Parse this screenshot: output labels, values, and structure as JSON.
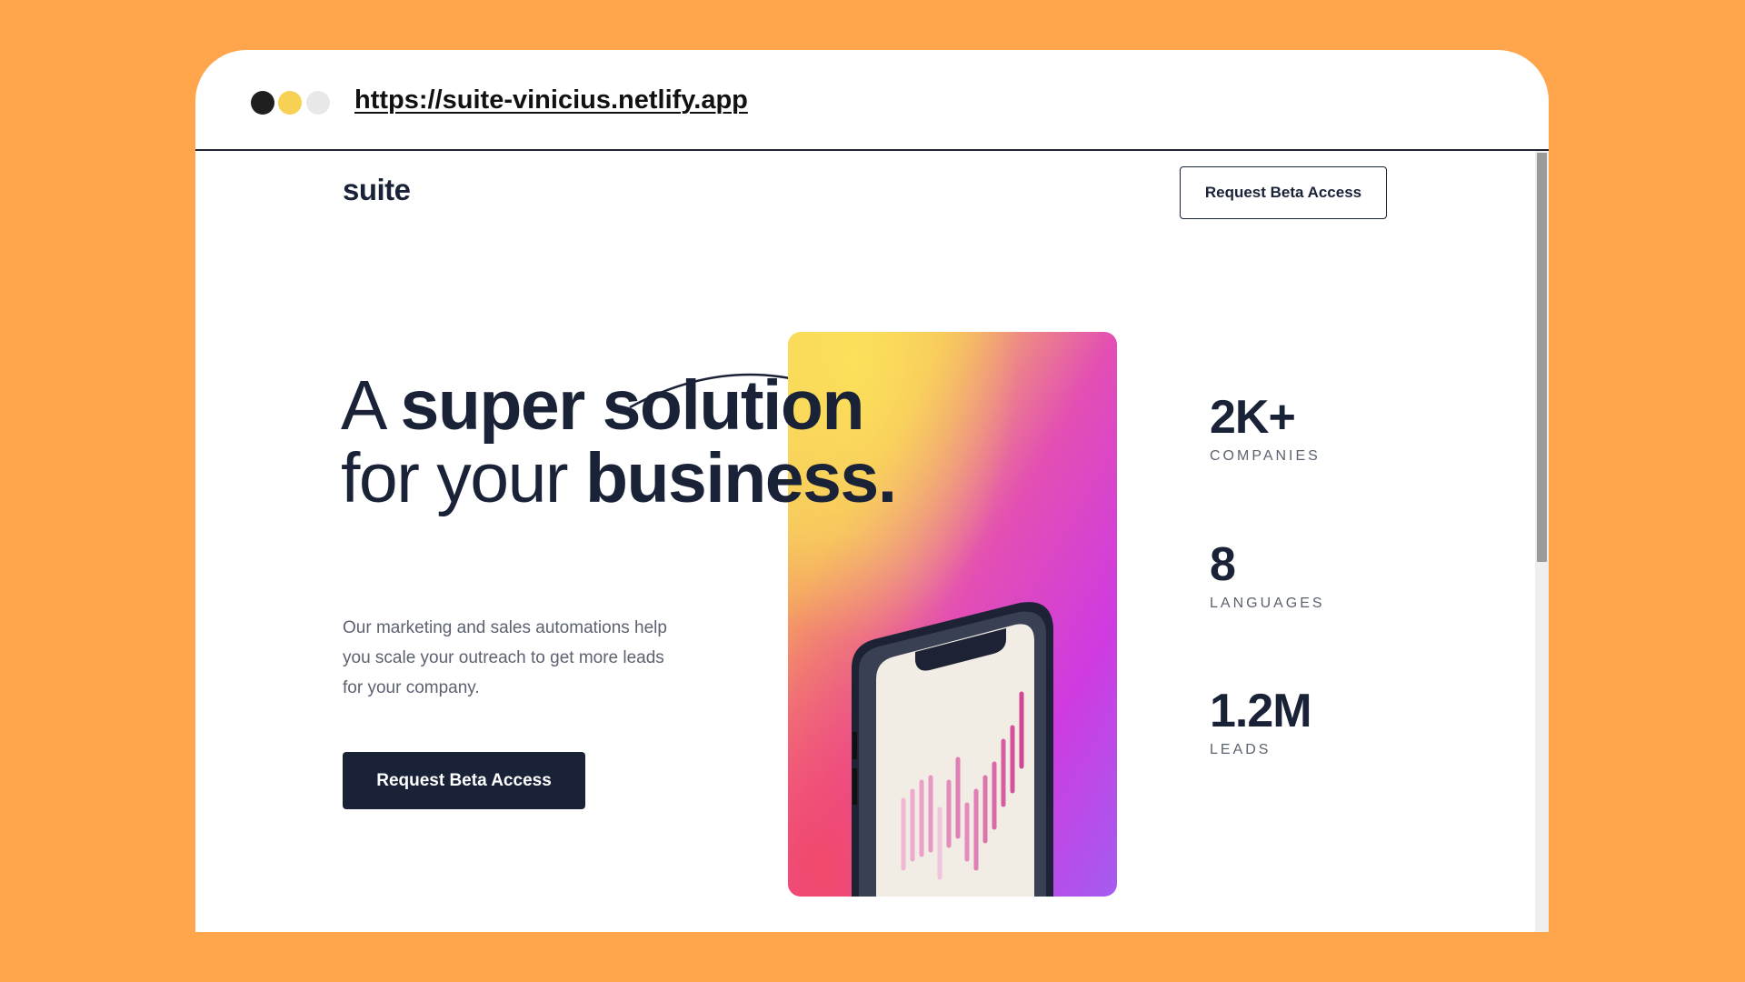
{
  "colors": {
    "background": "#FFA64D",
    "dot_black": "#1f1f1f",
    "dot_yellow": "#f7d154",
    "dot_gray": "#e8e8e8",
    "navy": "#1a2238"
  },
  "browser": {
    "url": "https://suite-vinicius.netlify.app"
  },
  "header": {
    "logo": "suite",
    "nav_button_label": "Request Beta Access"
  },
  "hero": {
    "headline_line1_light": "A ",
    "headline_line1_bold": "super solution",
    "headline_line2_light": "for your ",
    "headline_line2_bold": "business.",
    "description": "Our marketing and sales automations help you scale your outreach to get more leads for your company.",
    "cta_label": "Request Beta Access"
  },
  "stats": [
    {
      "value": "2K+",
      "label": "COMPANIES"
    },
    {
      "value": "8",
      "label": "LANGUAGES"
    },
    {
      "value": "1.2M",
      "label": "LEADS"
    }
  ],
  "icons": {
    "phone_image": "phone-chart-illustration",
    "arc": "decorative-arc"
  }
}
